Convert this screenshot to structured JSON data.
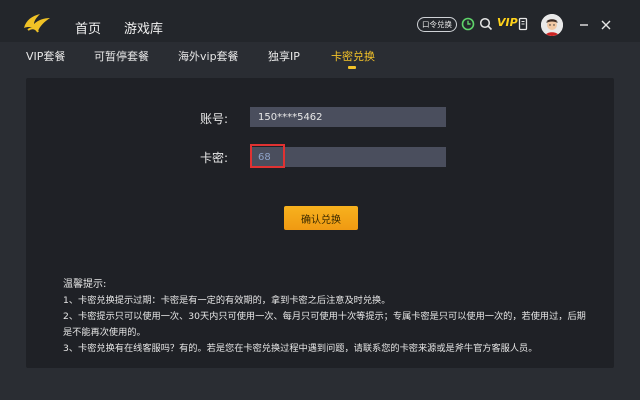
{
  "titlebar": {
    "nav": [
      "首页",
      "游戏库"
    ],
    "kouling_label": "口令兑换",
    "vip_label": "VIP"
  },
  "tabs": [
    {
      "label": "VIP套餐",
      "active": false
    },
    {
      "label": "可暂停套餐",
      "active": false
    },
    {
      "label": "海外vip套餐",
      "active": false
    },
    {
      "label": "独享IP",
      "active": false
    },
    {
      "label": "卡密兑换",
      "active": true
    }
  ],
  "form": {
    "account_label": "账号:",
    "account_value": "150****5462",
    "card_label": "卡密:",
    "card_value": "68",
    "confirm_label": "确认兑换"
  },
  "tips": {
    "title": "温馨提示:",
    "lines": [
      "1、卡密兑换提示过期：卡密是有一定的有效期的，拿到卡密之后注意及时兑换。",
      "2、卡密提示只可以使用一次、30天内只可使用一次、每月只可使用十次等提示；专属卡密是只可以使用一次的，若使用过，后期是不能再次使用的。",
      "3、卡密兑换有在线客服吗？有的。若是您在卡密兑换过程中遇到问题，请联系您的卡密来源或是斧牛官方客服人员。"
    ]
  },
  "colors": {
    "accent": "#f3c229",
    "button": "#f5a818",
    "background": "#2a2d33",
    "panel": "#1f2126",
    "input": "#4a4e5d"
  }
}
